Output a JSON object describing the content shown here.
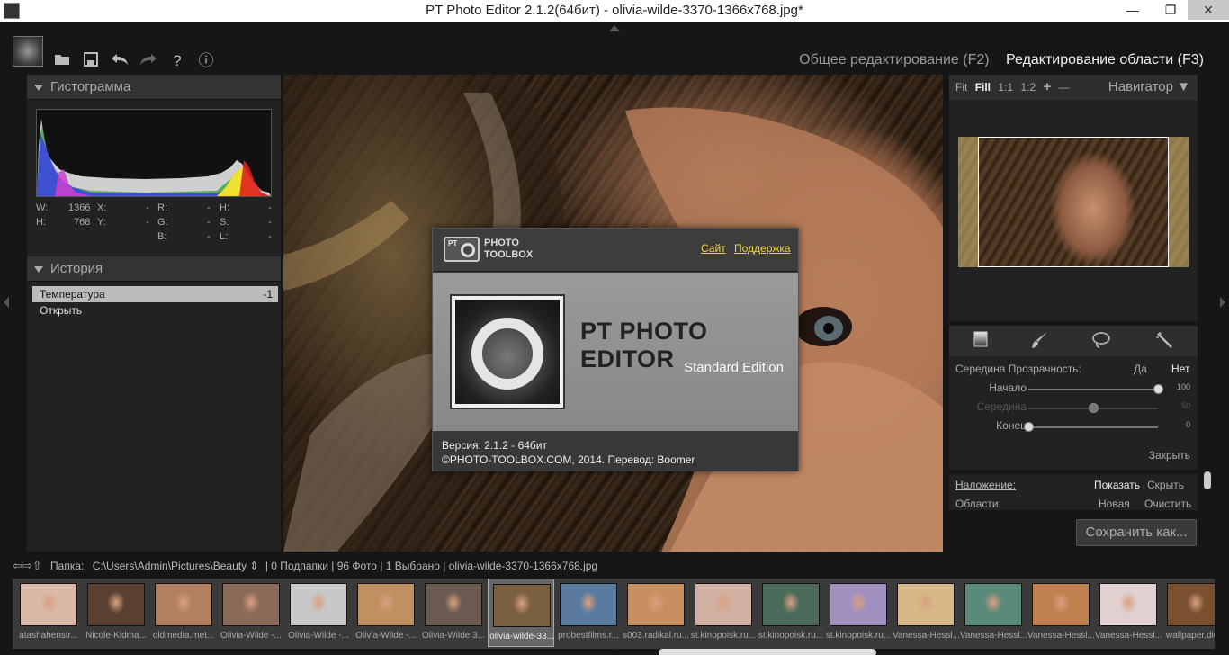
{
  "window": {
    "title": "PT Photo Editor 2.1.2(64бит) - olivia-wilde-3370-1366x768.jpg*",
    "minimize": "—",
    "maximize": "❐",
    "close": "✕"
  },
  "toolbar": {
    "open_icon": "folder-icon",
    "save_icon": "save-icon",
    "undo_icon": "undo-icon",
    "redo_icon": "redo-icon",
    "help_label": "?",
    "info_label": "ⓘ"
  },
  "mode_tabs": {
    "general": "Общее редактирование (F2)",
    "area": "Редактирование области (F3)"
  },
  "histogram": {
    "title": "Гистограмма",
    "w_label": "W:",
    "w_value": "1366",
    "h_label": "H:",
    "h_value": "768",
    "x_label": "X:",
    "x_value": "-",
    "y_label": "Y:",
    "y_value": "-",
    "r_label": "R:",
    "r_value": "-",
    "g_label": "G:",
    "g_value": "-",
    "b_label": "B:",
    "b_value": "-",
    "hh_label": "H:",
    "hh_value": "-",
    "s_label": "S:",
    "s_value": "-",
    "l_label": "L:",
    "l_value": "-"
  },
  "history": {
    "title": "История",
    "items": [
      {
        "label": "Температура",
        "value": "-1"
      },
      {
        "label": "Открыть",
        "value": ""
      }
    ]
  },
  "about": {
    "brand_line1": "PHOTO",
    "brand_line2": "TOOLBOX",
    "logo_pt": "PT",
    "link_site": "Сайт",
    "link_support": "Поддержка",
    "product": "PT PHOTO EDITOR",
    "edition": "Standard Edition",
    "version": "Версия: 2.1.2 - 64бит",
    "copyright": "©PHOTO-TOOLBOX.COM, 2014. Перевод: Boomer"
  },
  "navigator": {
    "title": "Навигатор",
    "zoom_fit": "Fit",
    "zoom_fill": "Fill",
    "zoom_1_1": "1:1",
    "zoom_1_2": "1:2",
    "zoom_in": "+",
    "zoom_out": "—"
  },
  "area_tools": {
    "opacity_label": "Середина Прозрачность:",
    "yes": "Да",
    "no": "Нет",
    "start_label": "Начало",
    "start_value": "100",
    "start_pct": 100,
    "mid_label": "Середина",
    "mid_value": "50",
    "mid_pct": 50,
    "end_label": "Конец",
    "end_value": "0",
    "end_pct": 0,
    "close": "Закрыть"
  },
  "overlay": {
    "overlay_label": "Наложение:",
    "show": "Показать",
    "hide": "Скрыть",
    "areas_label": "Области:",
    "new": "Новая",
    "clear": "Очистить"
  },
  "save_as": "Сохранить как...",
  "folder_bar": {
    "arrows": "⇦⇨⇧",
    "label": "Папка:",
    "path": "C:\\Users\\Admin\\Pictures\\Beauty ⇕",
    "stats": "| 0 Подпапки | 96 Фото | 1 Выбрано | olivia-wilde-3370-1366x768.jpg"
  },
  "filmstrip": {
    "thumbs": [
      {
        "caption": "atashahenstr...",
        "color": "#d9b8a8"
      },
      {
        "caption": "Nicole-Kidma...",
        "color": "#5a4030"
      },
      {
        "caption": "oldmedia.met...",
        "color": "#b08060"
      },
      {
        "caption": "Olivia-Wilde -...",
        "color": "#8a6a58"
      },
      {
        "caption": "Olivia-Wilde -...",
        "color": "#c8c8c8"
      },
      {
        "caption": "Olivia-Wilde -...",
        "color": "#c09060"
      },
      {
        "caption": "Olivia-Wilde 3...",
        "color": "#6a5a50"
      },
      {
        "caption": "olivia-wilde-33...",
        "color": "#7a6040"
      },
      {
        "caption": "probestfilms.r...",
        "color": "#5a7aa0"
      },
      {
        "caption": "s003.radikal.ru...",
        "color": "#c89060"
      },
      {
        "caption": "st.kinopoisk.ru...",
        "color": "#d0b0a0"
      },
      {
        "caption": "st.kinopoisk.ru...",
        "color": "#4a6a5a"
      },
      {
        "caption": "st.kinopoisk.ru...",
        "color": "#a090c0"
      },
      {
        "caption": "Vanessa-Hessl...",
        "color": "#d8b888"
      },
      {
        "caption": "Vanessa-Hessl...",
        "color": "#5a8a7a"
      },
      {
        "caption": "Vanessa-Hessl...",
        "color": "#c08050"
      },
      {
        "caption": "Vanessa-Hessl...",
        "color": "#e0d0d0"
      },
      {
        "caption": "wallpaper.dic...",
        "color": "#7a5030"
      }
    ]
  }
}
